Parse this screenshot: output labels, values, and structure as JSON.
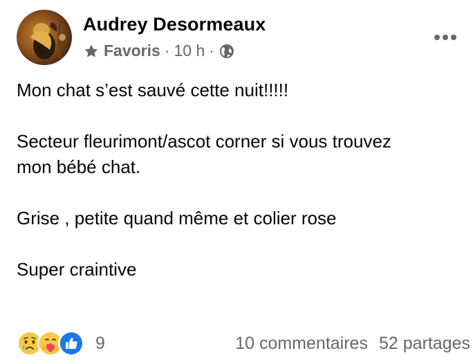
{
  "post": {
    "author": "Audrey Desormeaux",
    "meta": {
      "audience_icon": "star-icon",
      "audience_label": "Favoris",
      "separator": "·",
      "time": "10 h",
      "privacy_icon": "globe-icon"
    },
    "menu_icon": "more-icon",
    "lines": [
      "Mon chat s’est sauvé cette nuit!!!!!",
      "",
      "Secteur fleurimont/ascot corner si vous trouvez",
      "mon bébé chat.",
      "",
      "Grise , petite quand même et colier rose",
      "",
      "Super craintive"
    ]
  },
  "footer": {
    "reactions": [
      "sad-icon",
      "care-icon",
      "like-icon"
    ],
    "reaction_count": "9",
    "comments": "10 commentaires",
    "shares": "52 partages"
  },
  "colors": {
    "text": "#050505",
    "secondary": "#65676b",
    "like_blue": "#1877f2"
  }
}
